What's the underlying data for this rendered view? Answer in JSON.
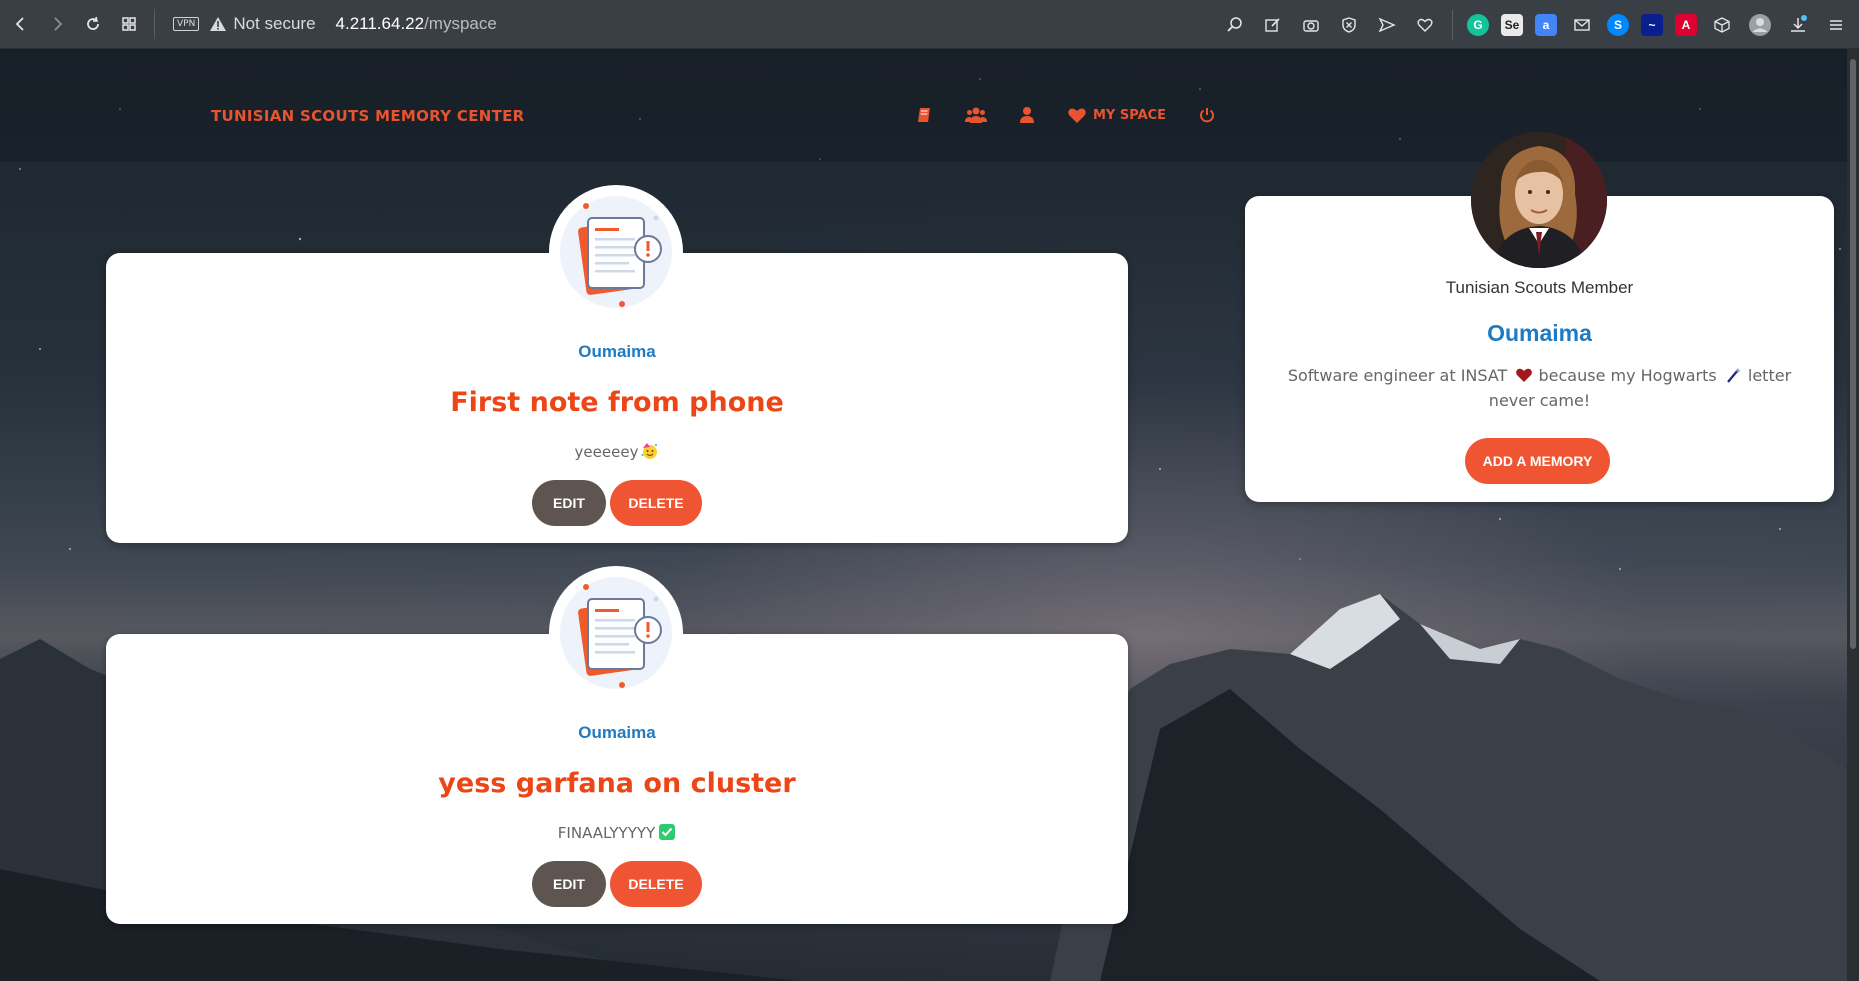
{
  "browser": {
    "vpn_label": "VPN",
    "security_label": "Not secure",
    "url_host": "4.211.64.22",
    "url_path": "/myspace"
  },
  "navbar": {
    "brand": "TUNISIAN SCOUTS MEMORY CENTER",
    "items": [
      {
        "icon": "book-icon"
      },
      {
        "icon": "users-icon"
      },
      {
        "icon": "user-icon"
      },
      {
        "icon": "heart-icon",
        "label": "MY SPACE"
      },
      {
        "icon": "power-icon"
      }
    ],
    "accent": "#e8542f"
  },
  "memories": [
    {
      "author": "Oumaima",
      "title": "First note from phone",
      "body": "yeeeeey",
      "body_emoji": "party-face-emoji",
      "edit_label": "EDIT",
      "delete_label": "DELETE"
    },
    {
      "author": "Oumaima",
      "title": "yess garfana on cluster",
      "body": "FINAALYYYYY",
      "body_emoji": "check-mark-emoji",
      "edit_label": "EDIT",
      "delete_label": "DELETE"
    }
  ],
  "profile": {
    "role": "Tunisian Scouts Member",
    "name": "Oumaima",
    "bio_part1": "Software engineer at INSAT",
    "bio_part2": "because my Hogwarts",
    "bio_part3": "letter never came!",
    "add_label": "ADD A MEMORY"
  },
  "colors": {
    "title": "#ec4616",
    "author": "#1f7bc1",
    "edit_button": "#5f5550",
    "delete_button": "#ef5533"
  }
}
